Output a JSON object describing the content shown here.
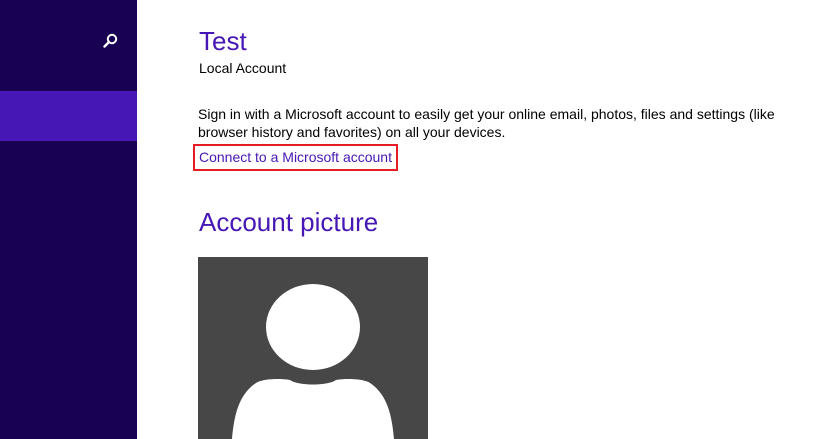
{
  "sidebar": {
    "search_icon": "search-icon",
    "selected_item_color": "#4617b4",
    "background_color": "#180052"
  },
  "account": {
    "user_name": "Test",
    "account_type": "Local Account",
    "description": "Sign in with a Microsoft account to easily get your online email, photos, files and settings (like browser history and favorites) on all your devices.",
    "connect_link": "Connect to a Microsoft account"
  },
  "picture_section": {
    "title": "Account picture",
    "avatar_icon": "default-user-silhouette",
    "avatar_background": "#474747"
  },
  "colors": {
    "accent": "#4617b4",
    "highlight_border": "#e51c23"
  }
}
